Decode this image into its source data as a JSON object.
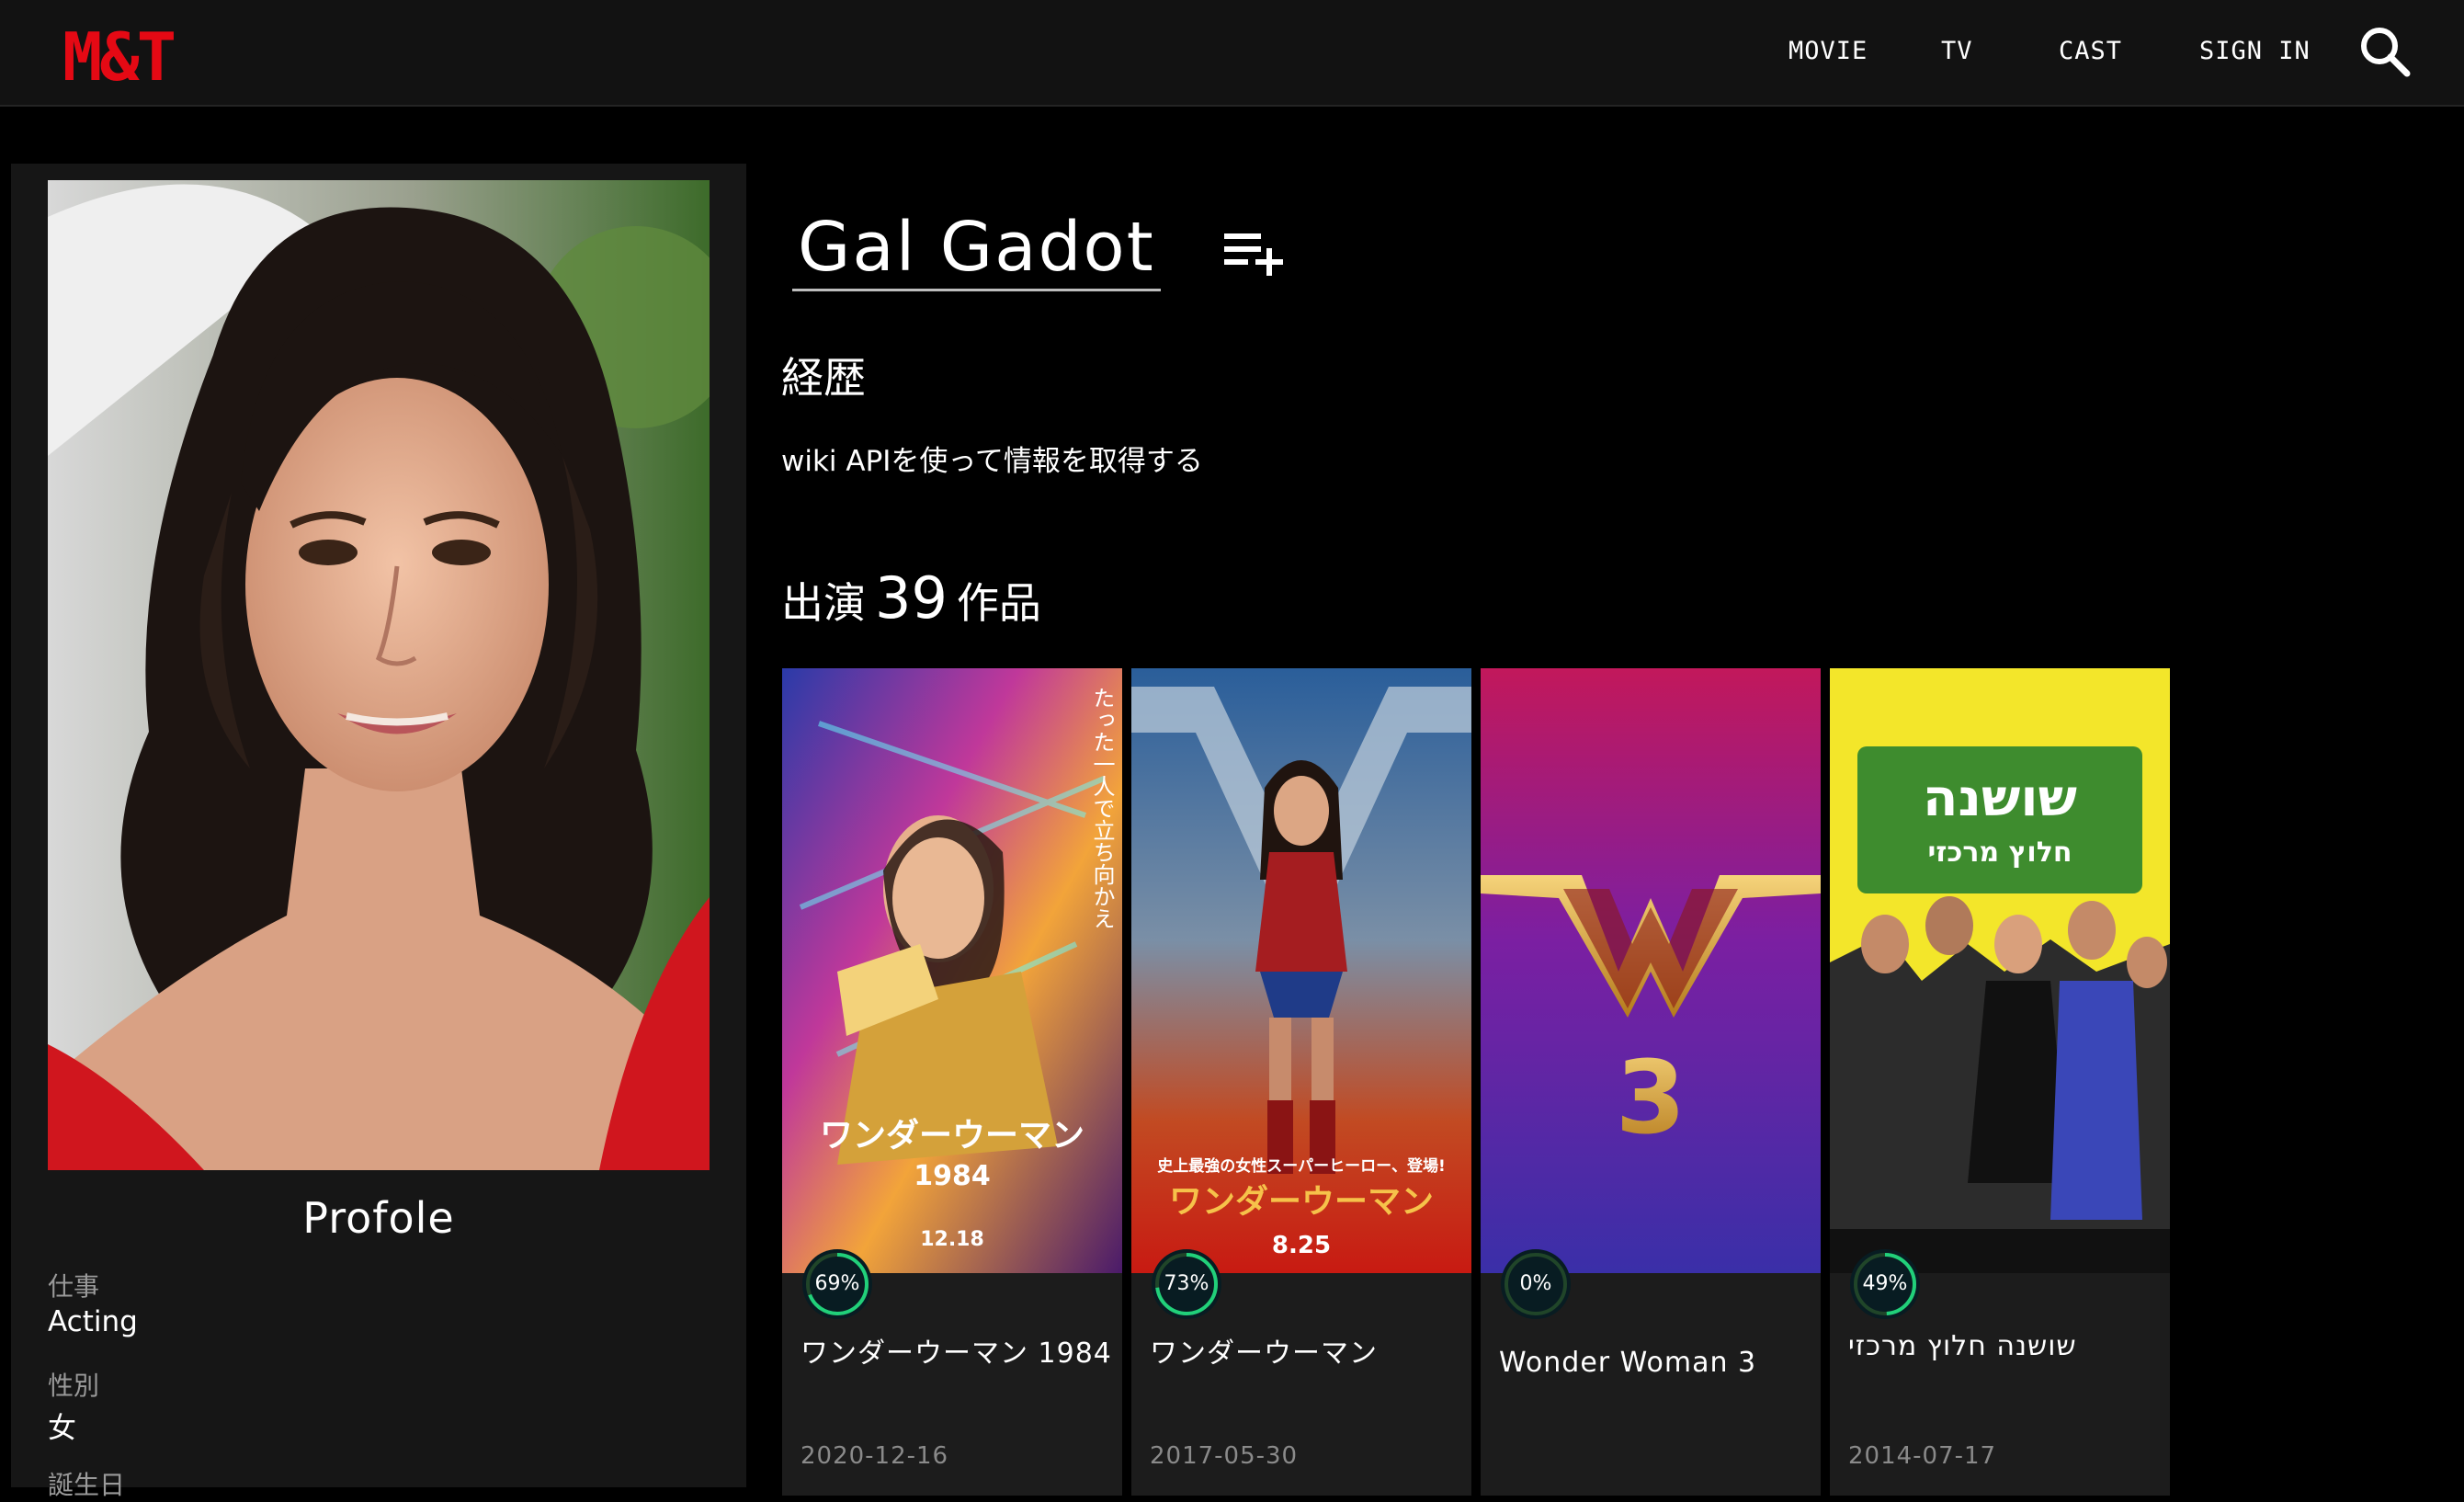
{
  "app": {
    "logo": "M&T"
  },
  "nav": {
    "items": [
      "MOVIE",
      "TV",
      "CAST",
      "SIGN IN"
    ]
  },
  "profile": {
    "heading": "Profole",
    "fields": [
      {
        "label": "仕事",
        "value": "Acting"
      },
      {
        "label": "性別",
        "value": "女"
      },
      {
        "label": "誕生日",
        "value": ""
      }
    ]
  },
  "person": {
    "name": "Gal Gadot",
    "bio_heading": "経歴",
    "bio_text": "wiki APIを使って情報を取得する",
    "credits_prefix": "出演",
    "credits_count": "39",
    "credits_suffix": "作品"
  },
  "credits": [
    {
      "title": "ワンダーウーマン 1984",
      "date": "2020-12-16",
      "score_label": "69%",
      "score": 69
    },
    {
      "title": "ワンダーウーマン",
      "date": "2017-05-30",
      "score_label": "73%",
      "score": 73
    },
    {
      "title": "Wonder Woman 3",
      "date": "",
      "score_label": "0%",
      "score": 0
    },
    {
      "title": "שושנה חלוץ מרכזי",
      "date": "2014-07-17",
      "score_label": "49%",
      "score": 49
    }
  ],
  "posters": [
    {
      "caption": "ワンダーウーマン",
      "sub": "1984",
      "tag": "12.18",
      "vertical": "たった一人で立ち向かえ",
      "icon": "wonder-woman-1984-poster"
    },
    {
      "caption": "ワンダーウーマン",
      "sub": "",
      "tag": "8.25",
      "vertical": "史上最強の女性スーパーヒーロー、登場!",
      "icon": "wonder-woman-poster"
    },
    {
      "caption": "",
      "sub": "",
      "tag": "3",
      "vertical": "",
      "icon": "wonder-woman-3-poster"
    },
    {
      "caption": "שושנה",
      "sub": "חלוץ מרכזי",
      "tag": "",
      "vertical": "",
      "icon": "shoshana-poster"
    }
  ],
  "colors": {
    "logo": "#e50914",
    "score_ring": "#21d07a",
    "score_track": "#204529"
  }
}
